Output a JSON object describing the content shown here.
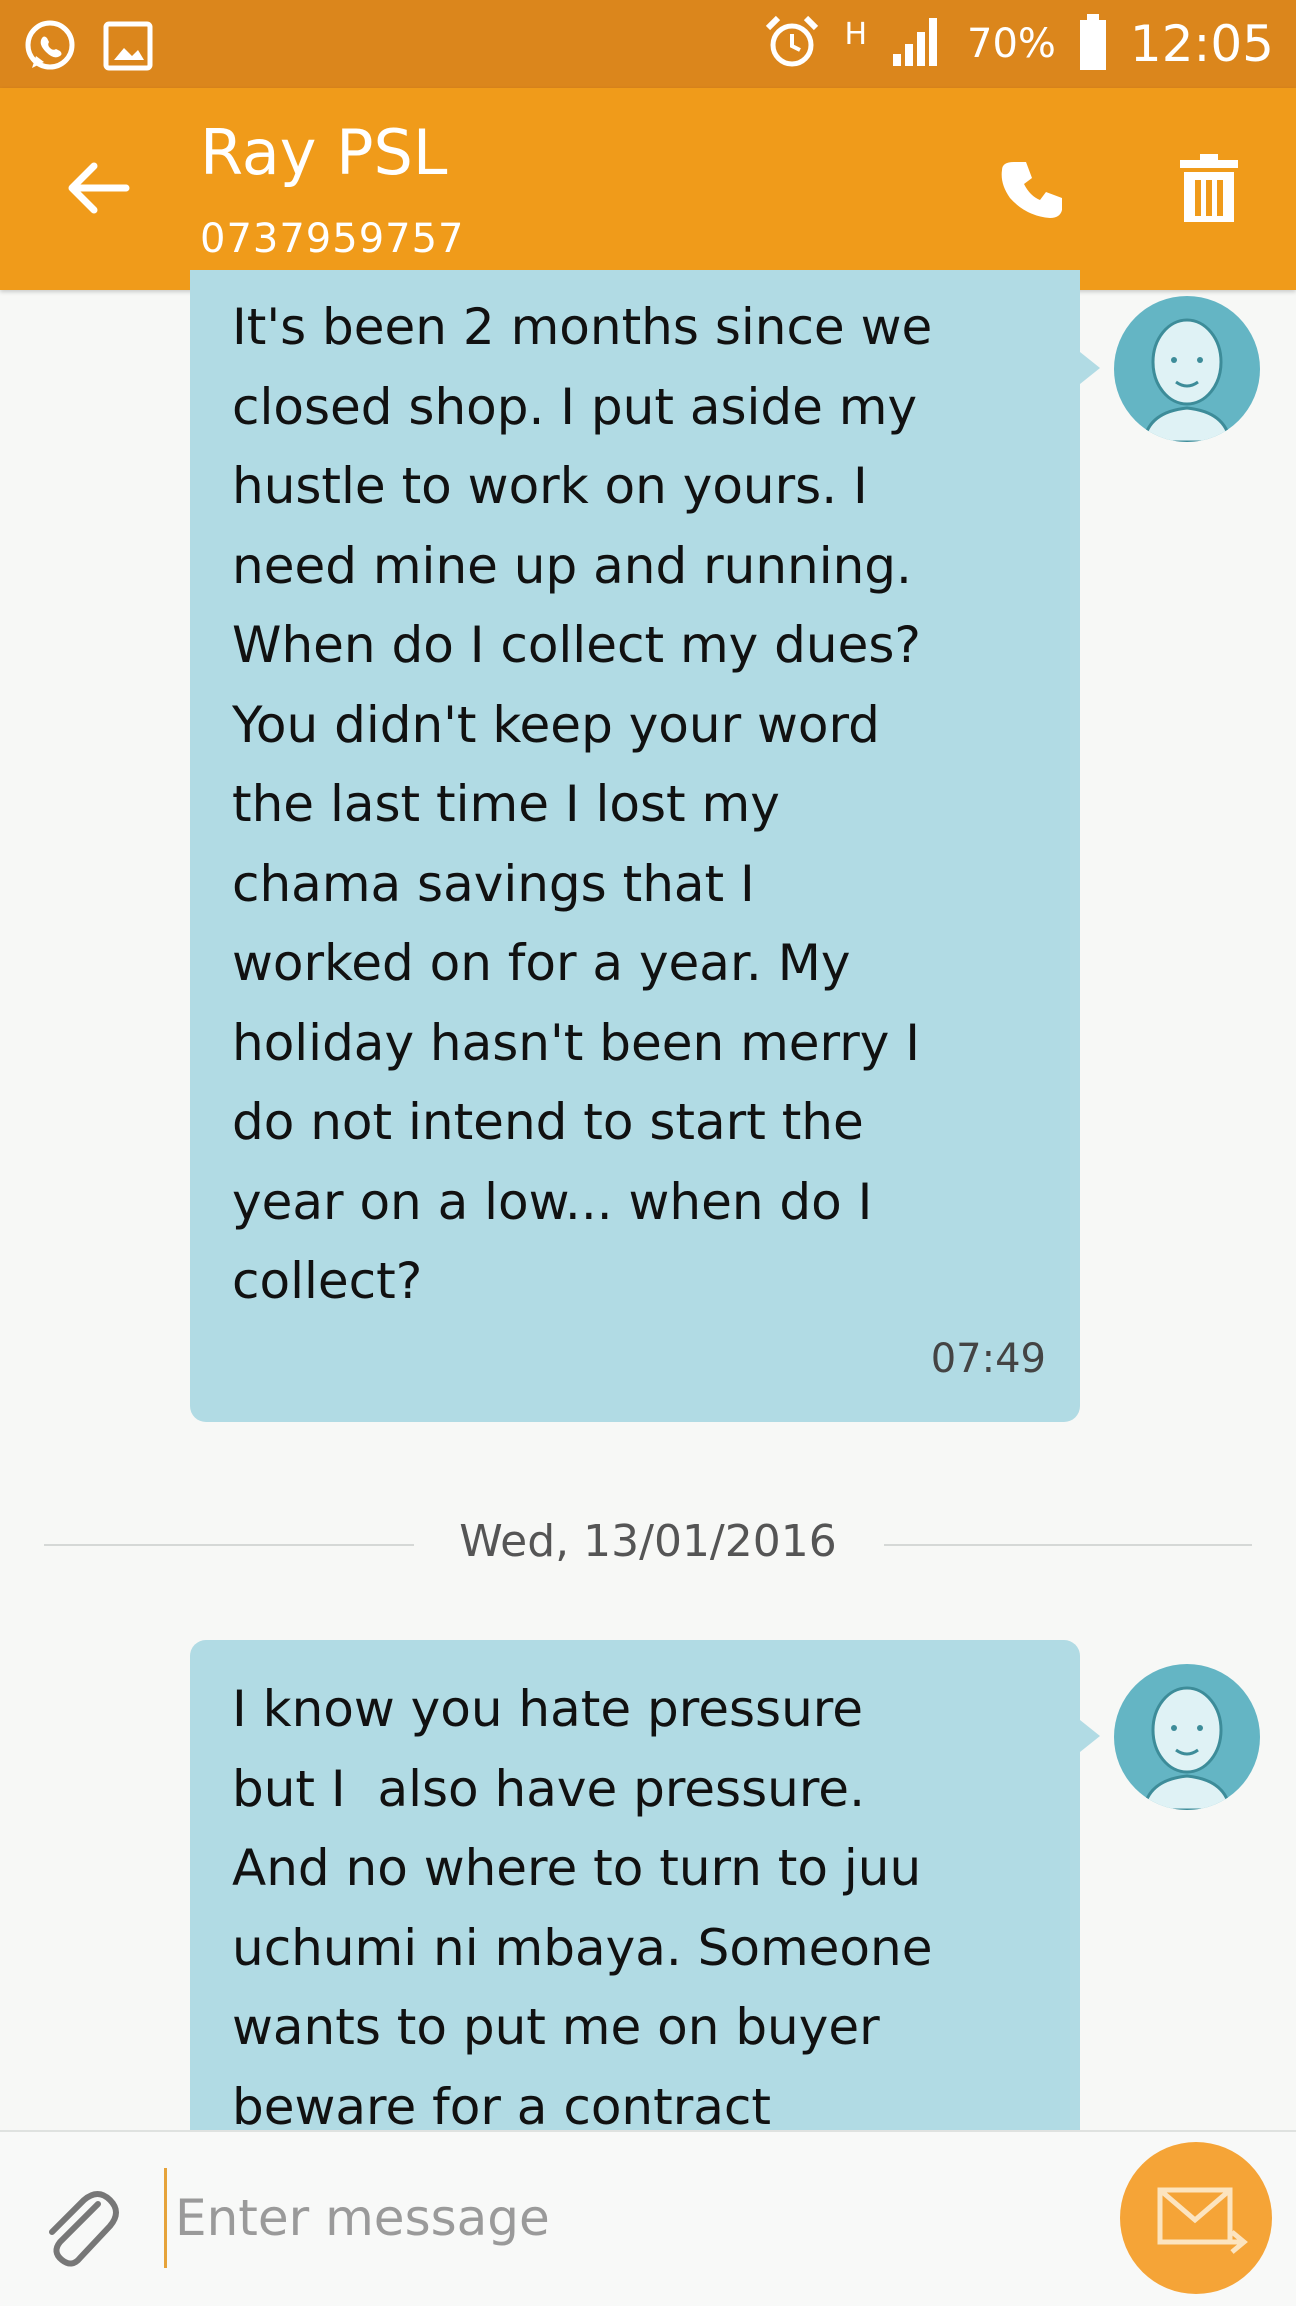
{
  "status_bar": {
    "network_type": "H",
    "battery": "70%",
    "time": "12:05"
  },
  "header": {
    "contact_name": "Ray PSL",
    "contact_number": "0737959757"
  },
  "messages": [
    {
      "text": "It's been 2 months since we\nclosed shop. I put aside my\nhustle to work on yours. I\nneed mine up and running.\nWhen do I collect my dues?\nYou didn't keep your word\nthe last time I lost my\nchama savings that I\nworked on for a year. My\nholiday hasn't been merry I\ndo not intend to start the\nyear on a low... when do I\ncollect?",
      "time": "07:49"
    },
    {
      "text": "I know you hate pressure\nbut I  also have pressure.\nAnd no where to turn to juu\nuchumi ni mbaya. Someone\nwants to put me on buyer\nbeware for a contract",
      "time": ""
    }
  ],
  "date_separator": "Wed, 13/01/2016",
  "composer": {
    "placeholder": "Enter message"
  },
  "icons": {
    "whatsapp": "whatsapp-icon",
    "gallery": "image-icon",
    "alarm": "alarm-icon",
    "signal": "signal-icon",
    "battery": "battery-icon",
    "back": "back-arrow-icon",
    "call": "phone-icon",
    "delete": "trash-icon",
    "attach": "paperclip-icon",
    "send": "envelope-send-icon"
  },
  "colors": {
    "status_bar": "#db861c",
    "app_bar": "#f09b1a",
    "bubble": "#b1dbe4",
    "avatar": "#64b5c4",
    "send_button": "#f5a437"
  }
}
